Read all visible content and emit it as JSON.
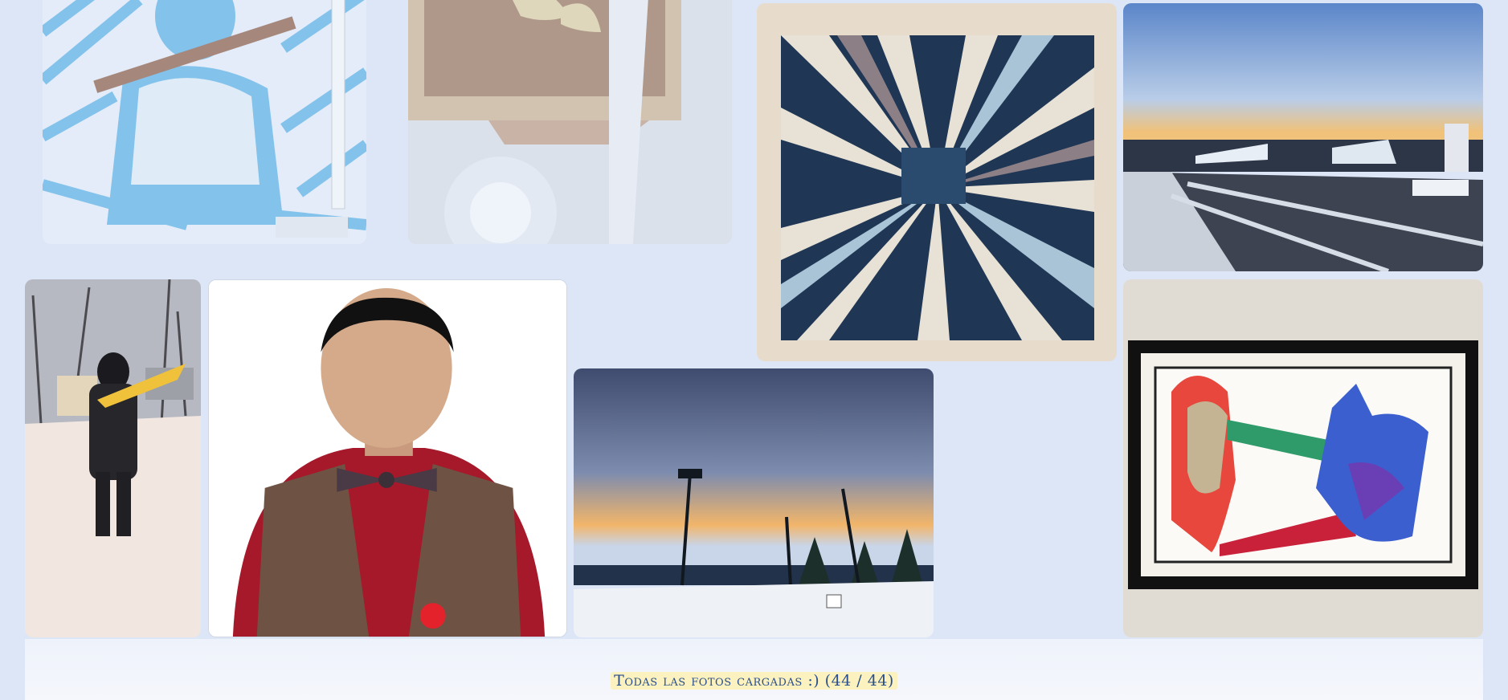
{
  "gallery": {
    "photos": [
      {
        "name": "axe-figure-painting",
        "alt": "Ilustración de hombre azul con hacha"
      },
      {
        "name": "wood-frame-reflection",
        "alt": "Marco de madera con hojas y reflejo de luz"
      },
      {
        "name": "indigo-quilt",
        "alt": "Colcha de retazos azules"
      },
      {
        "name": "snowy-street-sunset",
        "alt": "Calle nevada al atardecer"
      },
      {
        "name": "person-snow-walk",
        "alt": "Persona caminando en la nieve"
      },
      {
        "name": "portrait-vest",
        "alt": "Retrato con chaleco y moño"
      },
      {
        "name": "stadium-sunset",
        "alt": "Atardecer con postes de luz"
      },
      {
        "name": "framed-wolf-art",
        "alt": "Obra enmarcada de lobo y anciano"
      }
    ]
  },
  "footer": {
    "status": "Todas las fotos cargadas :) (44 / 44)"
  },
  "colors": {
    "page_bg": "#dde6f6",
    "status_text": "#2a4f8c",
    "status_highlight": "#fbf2c0"
  }
}
